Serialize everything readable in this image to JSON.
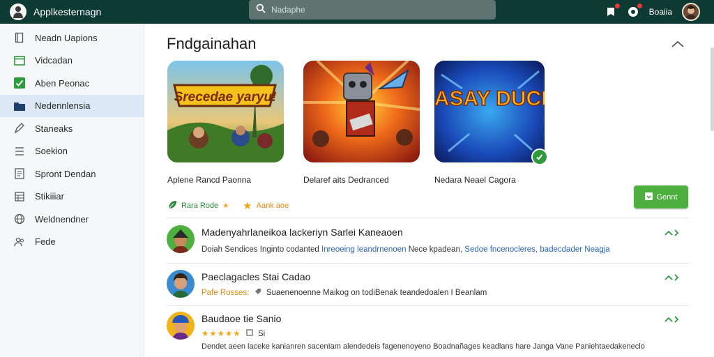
{
  "app": {
    "title": "Applkesternagn"
  },
  "search": {
    "placeholder": "Nadaphe"
  },
  "user": {
    "name": "Boaiia"
  },
  "sidebar": {
    "items": [
      {
        "label": "Neadn Uapions",
        "icon": "book-icon"
      },
      {
        "label": "Vidcadan",
        "icon": "window-icon"
      },
      {
        "label": "Aben Peonac",
        "icon": "check-icon"
      },
      {
        "label": "Nedennlensia",
        "icon": "folder-icon",
        "active": true
      },
      {
        "label": "Staneaks",
        "icon": "pen-icon"
      },
      {
        "label": "Soekion",
        "icon": "list-icon"
      },
      {
        "label": "Spront Dendan",
        "icon": "document-icon"
      },
      {
        "label": "Stikiiiar",
        "icon": "grid-icon"
      },
      {
        "label": "Weldnendner",
        "icon": "globe-icon"
      },
      {
        "label": "Fede",
        "icon": "people-icon"
      }
    ]
  },
  "section": {
    "title": "Fndgainahan"
  },
  "cards": [
    {
      "label": "Aplene Rancd Paonna",
      "art": "Srecedae yaryu!"
    },
    {
      "label": "Delaref aits Dedranced",
      "art": ""
    },
    {
      "label": "Nedara Neael Cagora",
      "art": "CLASAY DUCKG"
    }
  ],
  "meta": {
    "rating_label": "Rara Rode",
    "star_label": "Aank aoe"
  },
  "get_button": {
    "label": "Gennt"
  },
  "list": [
    {
      "title": "Madenyahrlaneikoa lackeriyn Sarlei Kaneaoen",
      "sub_plain": "Doiah Sendices Inginto codanted",
      "sub_blue": "Inreoeing leandrnenoen",
      "sub_plain2": "Nece kpadean,",
      "sub_blue2": "Sedoe fncenocleres, badecdader Neagja"
    },
    {
      "title": "Paeclagacles Stai Cadao",
      "sub_orange": "Pafe Rosses:",
      "sub_plain": "Suaenenoenne Maikog on todiBenak teandedoalen I Beanlam"
    },
    {
      "title": "Baudaoe tie Sanio",
      "stars": "★★★★★",
      "sub_short": "Si",
      "body": "Dendet aeen laceke kanianren sacenIam alendedeis fagenenoyeno Boadnañages keadlans hare Janga Vane Paniehtaedakeneclo"
    }
  ],
  "colors": {
    "topbar": "#0e3a34",
    "accent_green": "#4caf3e",
    "sidebar_active": "#dce8f6",
    "link_blue": "#2a66b8"
  }
}
